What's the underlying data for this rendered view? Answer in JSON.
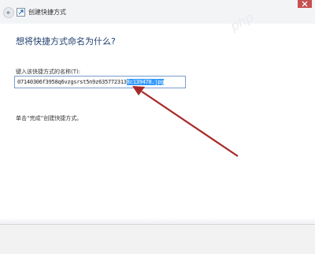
{
  "window": {
    "title": "创建快捷方式"
  },
  "dialog": {
    "heading": "想将快捷方式命名为什么?",
    "name_label": "键入该快捷方式的名称(T):",
    "name_value_plain": "07140306f3958q6vzgsrst5n9z635772313",
    "name_value_selected": "8c139478.jpg",
    "hint": "单击“完成”创建快捷方式。"
  },
  "watermark": "php",
  "colors": {
    "heading": "#1f3f6e",
    "selection": "#3399ff",
    "arrow": "#a8282a",
    "close_button": "#c75050"
  },
  "icons": {
    "back": "back-arrow-icon",
    "shortcut": "shortcut-icon",
    "close": "close-icon"
  }
}
